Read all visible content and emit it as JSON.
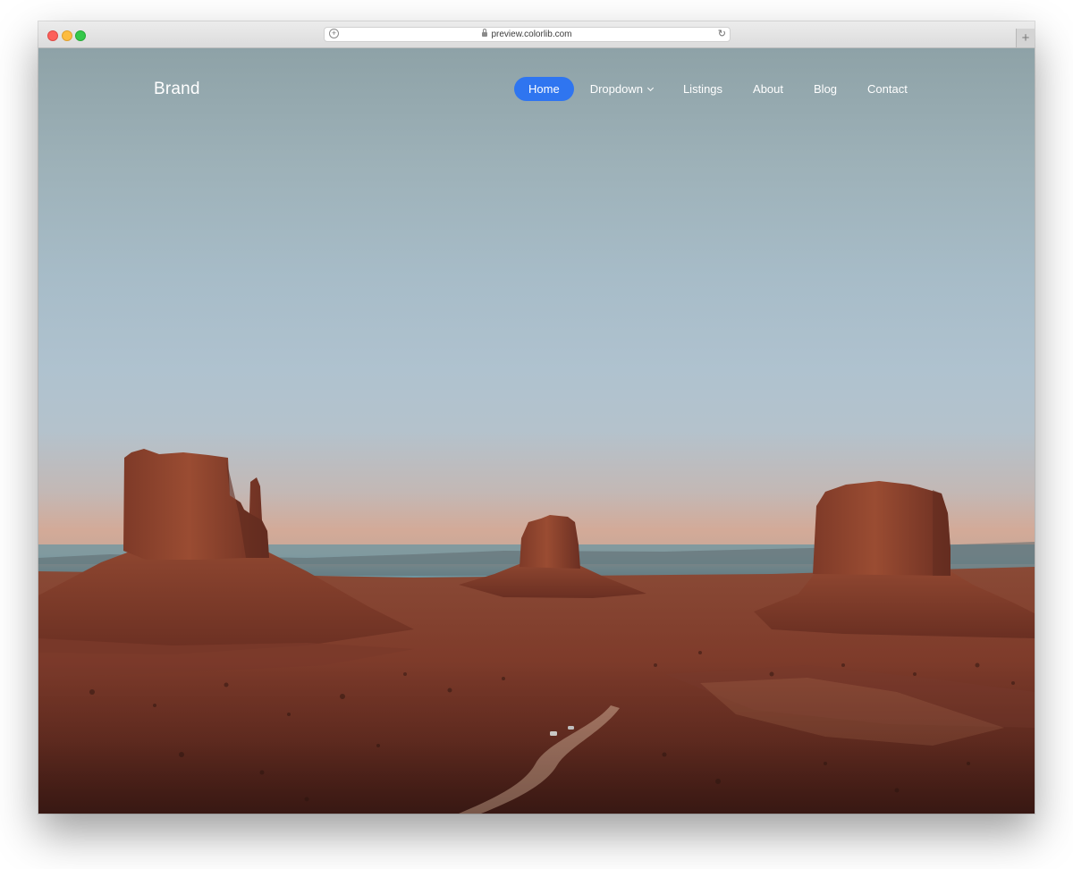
{
  "browser": {
    "url": "preview.colorlib.com",
    "new_tab_label": "+",
    "reload_glyph": "↻",
    "plus_glyph": "+"
  },
  "site": {
    "brand": "Brand",
    "nav": [
      {
        "label": "Home",
        "active": true
      },
      {
        "label": "Dropdown",
        "has_caret": true
      },
      {
        "label": "Listings"
      },
      {
        "label": "About"
      },
      {
        "label": "Blog"
      },
      {
        "label": "Contact"
      }
    ],
    "accent_color": "#2f75f0"
  },
  "hero": {
    "image_subject": "monument-valley-desert-landscape"
  }
}
